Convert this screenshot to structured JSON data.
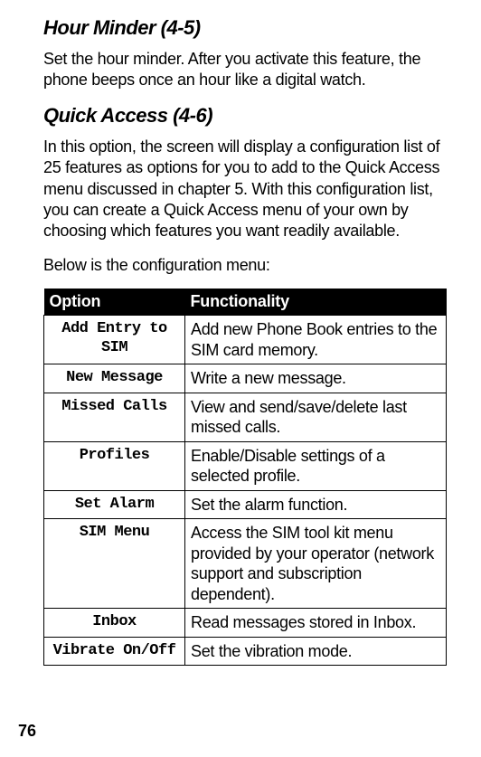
{
  "sections": {
    "hour_minder": {
      "heading": "Hour Minder (4-5)",
      "body": "Set the hour minder. After you activate this feature, the phone beeps once an hour like a digital watch."
    },
    "quick_access": {
      "heading": "Quick Access (4-6)",
      "body": "In this option, the screen will display a configuration list of 25 features as options for you to add to the Quick Access menu discussed in chapter 5. With this configuration list, you can create a Quick Access menu of your own by choosing which features you want readily available.",
      "subtext": "Below is the configuration menu:"
    }
  },
  "table": {
    "headers": {
      "option": "Option",
      "functionality": "Functionality"
    },
    "rows": [
      {
        "option": "Add Entry to SIM",
        "functionality": "Add new Phone Book entries to the SIM card memory."
      },
      {
        "option": "New Message",
        "functionality": "Write a new message."
      },
      {
        "option": "Missed Calls",
        "functionality": "View and send/save/delete last missed calls."
      },
      {
        "option": "Profiles",
        "functionality": "Enable/Disable settings of a selected profile."
      },
      {
        "option": "Set Alarm",
        "functionality": "Set the alarm function."
      },
      {
        "option": "SIM Menu",
        "functionality": "Access the SIM tool kit menu provided by your operator (network support and subscription dependent)."
      },
      {
        "option": "Inbox",
        "functionality": "Read messages stored in Inbox."
      },
      {
        "option": "Vibrate On/Off",
        "functionality": "Set the vibration mode."
      }
    ]
  },
  "page_number": "76"
}
